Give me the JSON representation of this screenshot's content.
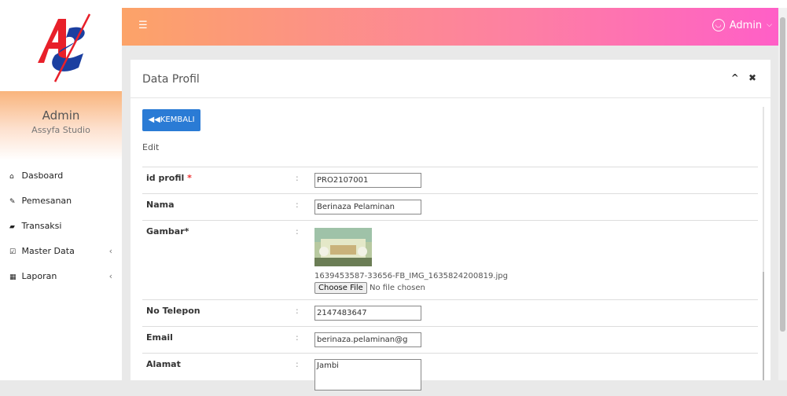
{
  "sidebar": {
    "user_name": "Admin",
    "studio_name": "Assyfa Studio",
    "menu": [
      {
        "label": "Dasboard",
        "icon": "home-icon",
        "has_chevron": false
      },
      {
        "label": "Pemesanan",
        "icon": "pencil-icon",
        "has_chevron": false
      },
      {
        "label": "Transaksi",
        "icon": "book-icon",
        "has_chevron": false
      },
      {
        "label": "Master Data",
        "icon": "edit-icon",
        "has_chevron": true
      },
      {
        "label": "Laporan",
        "icon": "calendar-icon",
        "has_chevron": true
      }
    ],
    "chevron": "‹"
  },
  "header": {
    "menu_icon": "hamburger-icon",
    "user_label": "Admin",
    "user_icon": "user-circle-icon"
  },
  "panel": {
    "title": "Data Profil",
    "back_label": "KEMBALI",
    "back_icon": "double-left-arrow-icon",
    "subtitle": "Edit"
  },
  "form": {
    "colon": ":",
    "id_profil": {
      "label": "id profil",
      "required_mark": "*",
      "value": "PRO2107001"
    },
    "nama": {
      "label": "Nama",
      "value": "Berinaza Pelaminan"
    },
    "gambar": {
      "label": "Gambar*",
      "filename": "1639453587-33656-FB_IMG_1635824200819.jpg",
      "choose_label": "Choose File",
      "no_file_text": "No file chosen"
    },
    "no_telepon": {
      "label": "No Telepon",
      "value": "2147483647"
    },
    "email": {
      "label": "Email",
      "value": "berinaza.pelaminan@g"
    },
    "alamat": {
      "label": "Alamat",
      "value": "Jambi"
    }
  },
  "colors": {
    "header_gradient_start": "#fca368",
    "header_gradient_end": "#ff5fc7",
    "button_blue": "#2a7bd5",
    "logo_red": "#e8202a",
    "logo_blue": "#1b3fa0"
  }
}
